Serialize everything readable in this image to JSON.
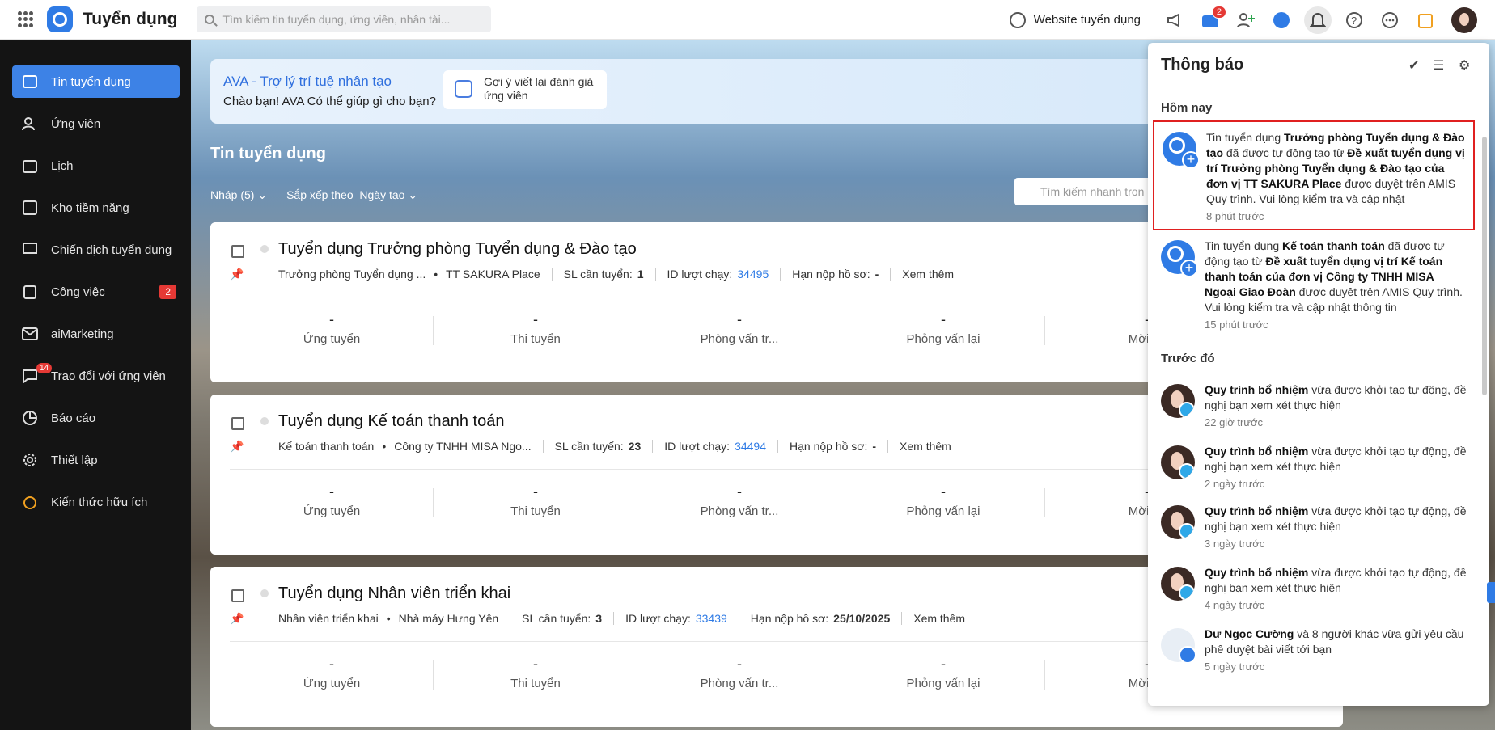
{
  "app": {
    "title": "Tuyển dụng",
    "search_placeholder": "Tìm kiếm tin tuyển dụng, ứng viên, nhân tài...",
    "website_label": "Website tuyển dụng",
    "cart_badge": "2",
    "accent": "#2f7be5"
  },
  "sidebar": {
    "items": [
      {
        "label": "Tin tuyển dụng",
        "icon": "job-list-icon"
      },
      {
        "label": "Ứng viên",
        "icon": "users-icon"
      },
      {
        "label": "Lịch",
        "icon": "calendar-icon"
      },
      {
        "label": "Kho tiềm năng",
        "icon": "talent-pool-icon"
      },
      {
        "label": "Chiến dịch tuyển dụng",
        "icon": "campaign-icon"
      },
      {
        "label": "Công việc",
        "icon": "task-icon",
        "count": "2"
      },
      {
        "label": "aiMarketing",
        "icon": "mail-icon"
      },
      {
        "label": "Trao đổi với ứng viên",
        "icon": "chat-icon",
        "dot": "14"
      },
      {
        "label": "Báo cáo",
        "icon": "report-icon"
      },
      {
        "label": "Thiết lập",
        "icon": "settings-icon"
      },
      {
        "label": "Kiến thức hữu ích",
        "icon": "knowledge-icon"
      }
    ]
  },
  "ava": {
    "title": "AVA - Trợ lý trí tuệ nhân tạo",
    "subtitle": "Chào bạn! AVA Có thể giúp gì cho bạn?",
    "suggestion": "Gợi ý viết lại đánh giá ứng viên"
  },
  "main": {
    "title": "Tin tuyển dụng",
    "filter_draft": "Nháp (5)",
    "sort_label": "Sắp xếp theo",
    "sort_value": "Ngày tạo",
    "quick_search": "Tìm kiếm nhanh tron"
  },
  "labels": {
    "sl_can_tuyen": "SL cần tuyển:",
    "id_luot_chay": "ID lượt chạy:",
    "han_nop": "Hạn nộp hồ sơ:",
    "xem_them": "Xem thêm",
    "stats": [
      "Ứng tuyển",
      "Thi tuyển",
      "Phòng vấn tr...",
      "Phỏng vấn lại",
      "Mời nh"
    ]
  },
  "jobs": [
    {
      "title": "Tuyển dụng Trưởng phòng Tuyển dụng & Đào tạo",
      "position": "Trưởng phòng Tuyển dụng ...",
      "unit": "TT SAKURA Place",
      "qty": "1",
      "run_id": "34495",
      "deadline": "-",
      "stat_value": "-"
    },
    {
      "title": "Tuyển dụng Kế toán thanh toán",
      "position": "Kế toán thanh toán",
      "unit": "Công ty TNHH MISA Ngo...",
      "qty": "23",
      "run_id": "34494",
      "deadline": "-",
      "stat_value": "-"
    },
    {
      "title": "Tuyển dụng Nhân viên triển khai",
      "position": "Nhân viên triển khai",
      "unit": "Nhà máy Hưng Yên",
      "qty": "3",
      "run_id": "33439",
      "deadline": "25/10/2025",
      "stat_value": "-"
    }
  ],
  "notifications": {
    "title": "Thông báo",
    "today": "Hôm nay",
    "earlier": "Trước đó",
    "items": [
      {
        "p1": "Tin tuyển dụng ",
        "b1": "Trưởng phòng Tuyển dụng & Đào tạo",
        "p2": " đã được tự động tạo từ ",
        "b2": "Đề xuất tuyển dụng vị trí Trưởng phòng Tuyển dụng & Đào tạo của đơn vị TT SAKURA Place",
        "p3": " được duyệt trên AMIS Quy trình. Vui lòng kiểm tra và cập nhật",
        "time": "8 phút trước"
      },
      {
        "p1": "Tin tuyển dụng ",
        "b1": "Kế toán thanh toán",
        "p2": " đã được tự động tạo từ ",
        "b2": "Đề xuất tuyển dụng vị trí Kế toán thanh toán của đơn vị Công ty TNHH MISA Ngoại Giao Đoàn",
        "p3": " được duyệt trên AMIS Quy trình. Vui lòng kiểm tra và cập nhật thông tin",
        "time": "15 phút trước"
      },
      {
        "b1": "Quy trình bổ nhiệm",
        "p2": " vừa được khởi tạo tự động, đề nghị bạn xem xét thực hiện",
        "time": "22 giờ trước"
      },
      {
        "b1": "Quy trình bổ nhiệm",
        "p2": " vừa được khởi tạo tự động, đề nghị bạn xem xét thực hiện",
        "time": "2 ngày trước"
      },
      {
        "b1": "Quy trình bổ nhiệm",
        "p2": " vừa được khởi tạo tự động, đề nghị bạn xem xét thực hiện",
        "time": "3 ngày trước"
      },
      {
        "b1": "Quy trình bổ nhiệm",
        "p2": " vừa được khởi tạo tự động, đề nghị bạn xem xét thực hiện",
        "time": "4 ngày trước"
      },
      {
        "b1": "Dư Ngọc Cường",
        "p2": " và 8 người khác vừa gửi yêu cầu phê duyệt bài viết tới bạn",
        "time": "5 ngày trước"
      }
    ]
  }
}
